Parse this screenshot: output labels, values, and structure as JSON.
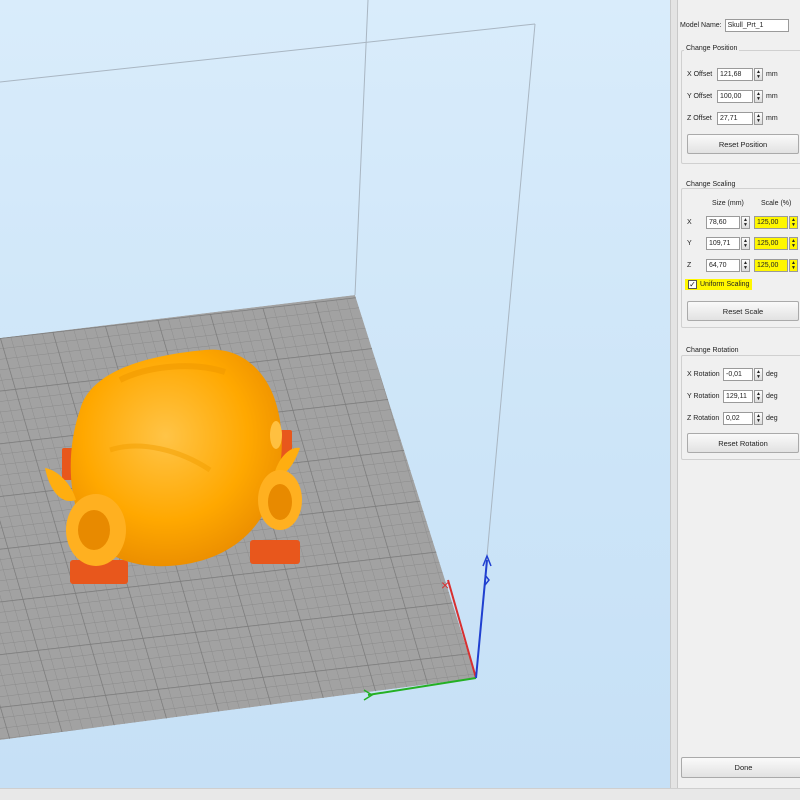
{
  "model": {
    "name_label": "Model Name:",
    "name_value": "Skull_Prt_1"
  },
  "position": {
    "title": "Change Position",
    "fields": [
      {
        "label": "X Offset",
        "value": "121,68",
        "unit": "mm"
      },
      {
        "label": "Y Offset",
        "value": "100,00",
        "unit": "mm"
      },
      {
        "label": "Z Offset",
        "value": "27,71",
        "unit": "mm"
      }
    ],
    "reset_label": "Reset Position"
  },
  "scaling": {
    "title": "Change Scaling",
    "size_header": "Size (mm)",
    "scale_header": "Scale (%)",
    "rows": [
      {
        "axis": "X",
        "size": "78,60",
        "scale": "125,00"
      },
      {
        "axis": "Y",
        "size": "109,71",
        "scale": "125,00"
      },
      {
        "axis": "Z",
        "size": "64,70",
        "scale": "125,00"
      }
    ],
    "uniform_label": "Uniform Scaling",
    "uniform_checked": true,
    "reset_label": "Reset Scale",
    "highlight_color": "#fff700"
  },
  "rotation": {
    "title": "Change Rotation",
    "fields": [
      {
        "label": "X Rotation",
        "value": "-0,01",
        "unit": "deg"
      },
      {
        "label": "Y Rotation",
        "value": "129,11",
        "unit": "deg"
      },
      {
        "label": "Z Rotation",
        "value": "0,02",
        "unit": "deg"
      }
    ],
    "reset_label": "Reset Rotation"
  },
  "done_label": "Done",
  "viewport": {
    "model_color": "#ffa600",
    "support_color": "#e8571c",
    "bed_color": "#9c9c9c",
    "axis_x_color": "#d83030",
    "axis_y_color": "#24b024",
    "axis_z_color": "#2040d0"
  }
}
